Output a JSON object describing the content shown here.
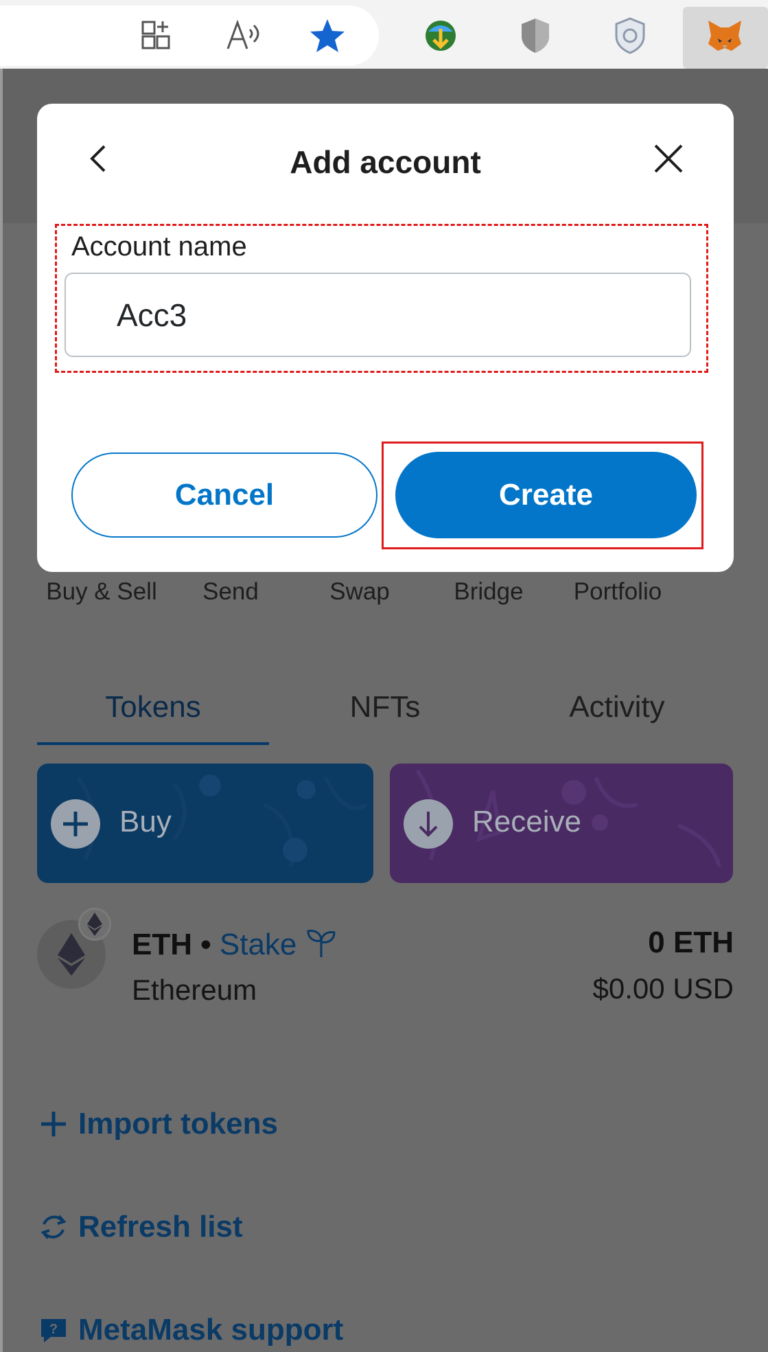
{
  "browser": {
    "icons": [
      "add-to-collection-icon",
      "read-aloud-icon",
      "favorite-star-icon",
      "download-manager-icon",
      "shield-icon",
      "privacy-shield-icon",
      "metamask-fox-icon"
    ]
  },
  "modal": {
    "title": "Add account",
    "field_label": "Account name",
    "field_value": "Acc3",
    "cancel_label": "Cancel",
    "create_label": "Create"
  },
  "actions": {
    "labels": [
      "Buy & Sell",
      "Send",
      "Swap",
      "Bridge",
      "Portfolio"
    ]
  },
  "tabs": [
    "Tokens",
    "NFTs",
    "Activity"
  ],
  "cards": {
    "buy_label": "Buy",
    "receive_label": "Receive"
  },
  "token": {
    "symbol": "ETH",
    "separator": "•",
    "stake_label": "Stake",
    "chain": "Ethereum",
    "amount": "0 ETH",
    "usd": "$0.00 USD"
  },
  "links": {
    "import_tokens": "Import tokens",
    "refresh_list": "Refresh list",
    "support": "MetaMask support"
  },
  "colors": {
    "accent": "#0376c9",
    "highlight": "#e01b1b",
    "overlay": "#6b6b6b"
  }
}
